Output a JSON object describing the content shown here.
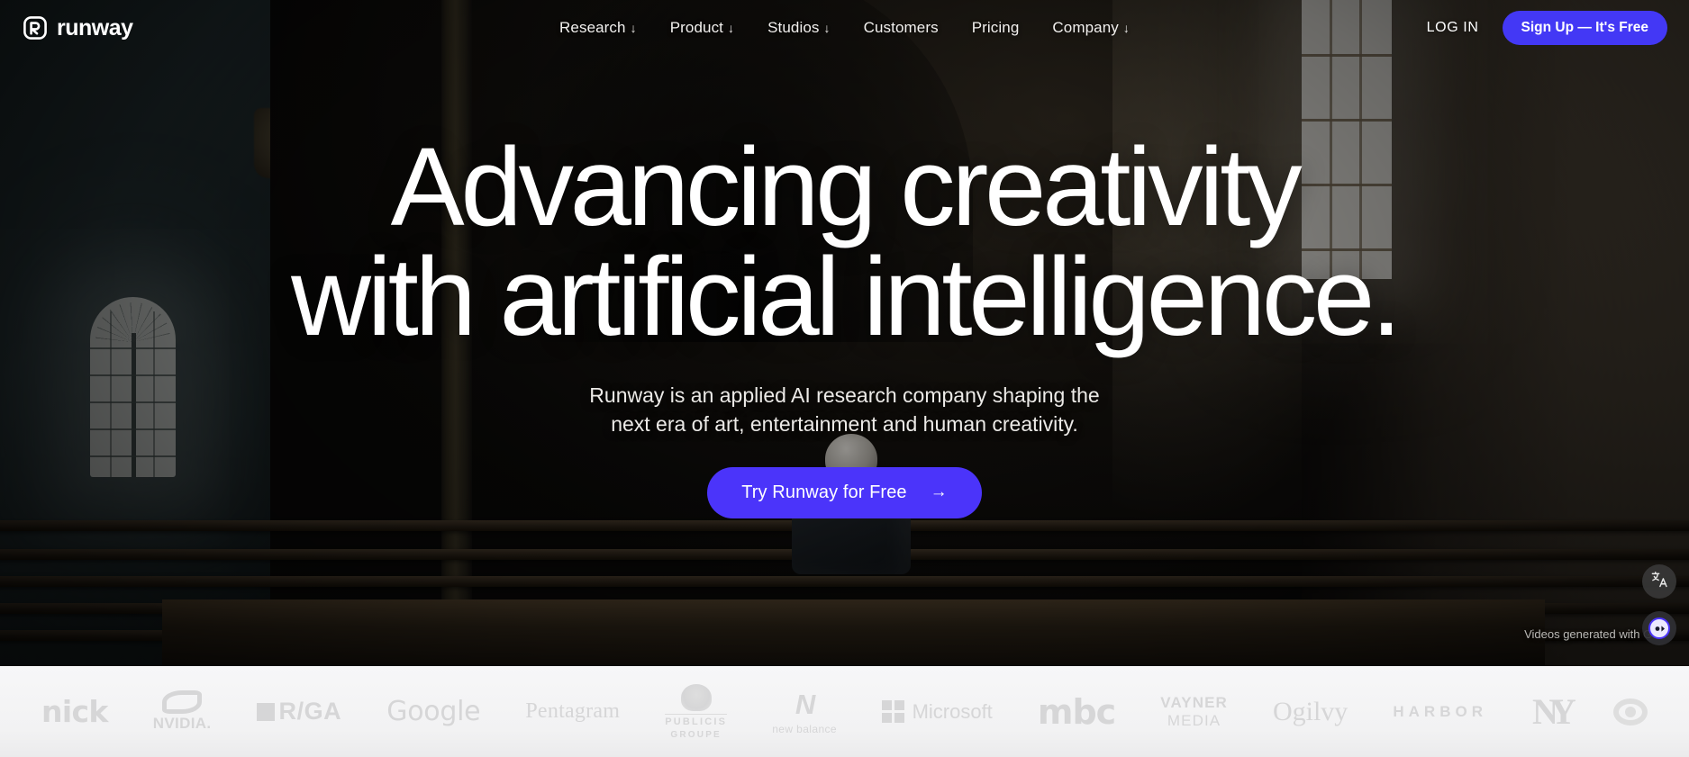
{
  "brand": {
    "name": "runway",
    "logo_icon": "runway-r-mark-icon"
  },
  "nav": {
    "links": [
      {
        "label": "Research",
        "caret": "↓"
      },
      {
        "label": "Product",
        "caret": "↓"
      },
      {
        "label": "Studios",
        "caret": "↓"
      },
      {
        "label": "Customers",
        "caret": ""
      },
      {
        "label": "Pricing",
        "caret": ""
      },
      {
        "label": "Company",
        "caret": "↓"
      }
    ],
    "login_label": "LOG IN",
    "signup_label": "Sign Up — It's Free"
  },
  "hero": {
    "headline_line1": "Advancing creativity",
    "headline_line2": "with artificial intelligence.",
    "subtitle_line1": "Runway is an applied AI research company shaping the",
    "subtitle_line2": "next era of art, entertainment and human creativity.",
    "cta_label": "Try Runway for Free",
    "cta_arrow": "→",
    "video_caption": "Videos generated with Gen-"
  },
  "widgets": {
    "translate_icon": "translate-icon",
    "translate_glyph": "文",
    "translate_glyph2": "A",
    "chat_icon": "chat-support-icon"
  },
  "logobar": {
    "logos": [
      {
        "name": "nick",
        "text": "nick"
      },
      {
        "name": "nvidia",
        "text": "NVIDIA."
      },
      {
        "name": "rga",
        "text": "R/GA"
      },
      {
        "name": "google",
        "text": "Google"
      },
      {
        "name": "pentagram",
        "text": "Pentagram"
      },
      {
        "name": "publicis",
        "text": "PUBLICIS",
        "text2": "GROUPE"
      },
      {
        "name": "new-balance",
        "text": "N",
        "text2": "new balance"
      },
      {
        "name": "microsoft",
        "text": "Microsoft"
      },
      {
        "name": "mbc",
        "text": "mbc"
      },
      {
        "name": "vaynermedia",
        "text": "VAYNER",
        "text2": "MEDIA"
      },
      {
        "name": "ogilvy",
        "text": "Ogilvy"
      },
      {
        "name": "harbor",
        "text": "HARBOR"
      },
      {
        "name": "new-york-yankees",
        "text": "NY"
      },
      {
        "name": "cbs",
        "text": ""
      }
    ]
  },
  "colors": {
    "accent": "#4b34fa",
    "signup_button": "#4338f5",
    "hero_text": "#ffffff",
    "logobar_bg": "#f4f4f5",
    "logo_gray": "#d6d6d7"
  }
}
